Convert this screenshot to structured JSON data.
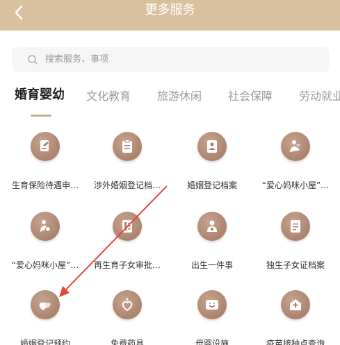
{
  "header": {
    "title": "更多服务",
    "background_color": "#d9c1a0"
  },
  "search": {
    "placeholder": "搜索服务、事项"
  },
  "tabs": [
    {
      "label": "婚育婴幼",
      "active": true
    },
    {
      "label": "文化教育",
      "active": false
    },
    {
      "label": "旅游休闲",
      "active": false
    },
    {
      "label": "社会保障",
      "active": false
    },
    {
      "label": "劳动就业",
      "active": false
    }
  ],
  "services": [
    {
      "label": "生育保险待遇申…",
      "icon": "document-pen-icon"
    },
    {
      "label": "涉外婚姻登记档…",
      "icon": "clipboard-icon"
    },
    {
      "label": "婚姻登记档案",
      "icon": "person-card-icon"
    },
    {
      "label": "“爱心妈咪小屋”…",
      "icon": "heart-hand-icon"
    },
    {
      "label": "“爱心妈咪小屋”…",
      "icon": "mother-baby-icon"
    },
    {
      "label": "再生育子女审批…",
      "icon": "book-icon"
    },
    {
      "label": "出生一件事",
      "icon": "baby-icon"
    },
    {
      "label": "独生子女证档案",
      "icon": "document-icon"
    },
    {
      "label": "婚姻登记预约",
      "icon": "hearts-icon"
    },
    {
      "label": "免费药具",
      "icon": "heart-chain-icon"
    },
    {
      "label": "母婴设施",
      "icon": "mother-baby-room-icon"
    },
    {
      "label": "疫苗接种点查询",
      "icon": "hospital-icon"
    }
  ],
  "colors": {
    "accent": "#c9a987",
    "icon_bg": "#a98170",
    "annotation_arrow": "#e8453c"
  }
}
